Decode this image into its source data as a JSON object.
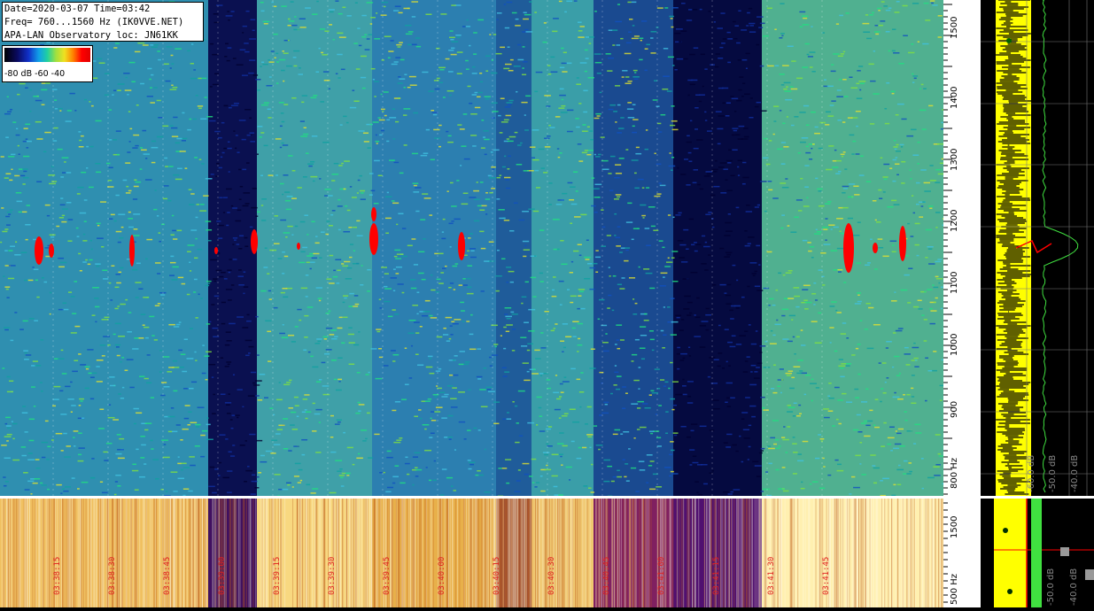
{
  "header": {
    "line1": "Date=2020-03-07 Time=03:42",
    "line2": "Freq= 760...1560 Hz (IK0VVE.NET)",
    "line3": "APA-LAN Observatory loc: JN61KK"
  },
  "colorbar": {
    "labels": "-80 dB -60      -40"
  },
  "freq_axis": {
    "ticks": [
      "1500",
      "1400",
      "1300",
      "1200",
      "1100",
      "1000",
      "900",
      "800 Hz"
    ]
  },
  "bottom_axis": {
    "ticks": [
      "1500",
      "500 Hz"
    ]
  },
  "spectrum": {
    "top_labels": [
      "-60.0 dB",
      "-50.0 dB",
      "-40.0 dB"
    ],
    "bottom_labels": [
      "-50.0 dB",
      "-40.0 dB"
    ]
  },
  "time_labels": [
    "03:38:15",
    "03:38:30",
    "03:38:45",
    "03:39:00",
    "03:39:15",
    "03:39:30",
    "03:39:45",
    "03:40:00",
    "03:40:15",
    "03:40:30",
    "03:40:45",
    "03:41:00",
    "03:41:15",
    "03:41:30",
    "03:41:45"
  ],
  "colors": {
    "waterfall_bg": "#1f5f9a",
    "bottom_waterfall_bg": "#e8b14a",
    "spectrum_yellow": "#ffff00",
    "spectrum_green": "#40e040",
    "echo_red": "#ff0000"
  }
}
